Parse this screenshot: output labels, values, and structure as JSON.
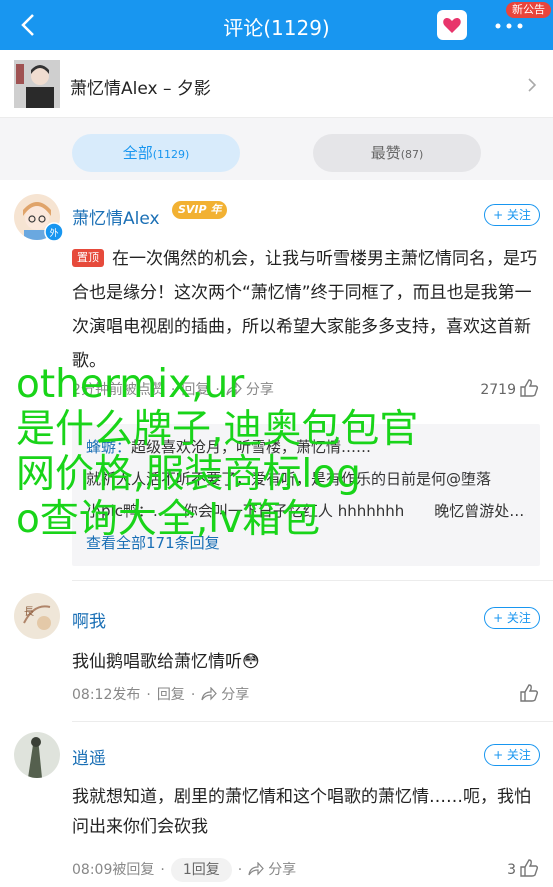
{
  "header": {
    "title": "评论(1129)",
    "notice_badge": "新公告",
    "accent": "#1896f0"
  },
  "source": {
    "title": "萧忆情Alex – 夕影"
  },
  "tabs": [
    {
      "label": "全部",
      "count": "(1129)"
    },
    {
      "label": "最赞",
      "count": "(87)"
    }
  ],
  "comments": [
    {
      "user": "萧忆情Alex",
      "badge": "SVIP",
      "badge_suffix": "年",
      "follow": "+ 关注",
      "pin": "置顶",
      "text": "在一次偶然的机会，让我与听雪楼男主萧忆情同名，是巧合也是缘分！这次两个“萧忆情”终于同框了，而且也是我第一次演唱电视剧的插曲，所以希望大家能多多支持，喜欢这首新歌。",
      "time": "2分钟前被点赞",
      "reply": "回复",
      "share": "分享",
      "likes": "2719",
      "replies": [
        {
          "name": "蜂蝣：",
          "text": "超级喜欢沧月，听雪楼，萧忆情……"
        },
        {
          "name": "",
          "text": "就祈人人活不听不要了，爱有听，是有作乐的日前是何@堕落"
        },
        {
          "name": "",
          "text": "小pic鸭：……你会叫一下日子忆红人 hhhhhhh　　晚忆曾游处……"
        }
      ],
      "view_all": "查看全部171条回复"
    },
    {
      "user": "啊我",
      "follow": "+ 关注",
      "text": "我仙鹅唱歌给萧忆情听😳",
      "time": "08:12发布",
      "reply": "回复",
      "share": "分享",
      "likes": ""
    },
    {
      "user": "逍遥",
      "follow": "+ 关注",
      "text": "我就想知道，剧里的萧忆情和这个唱歌的萧忆情……呃，我怕问出来你们会砍我",
      "time": "08:09被回复",
      "reply": "1回复",
      "share": "分享",
      "likes": "3"
    }
  ],
  "watermark": "othermix,ur\n是什么牌子,迪奥包包官\n网价格,服装商标log\no查询大全,lv箱包"
}
